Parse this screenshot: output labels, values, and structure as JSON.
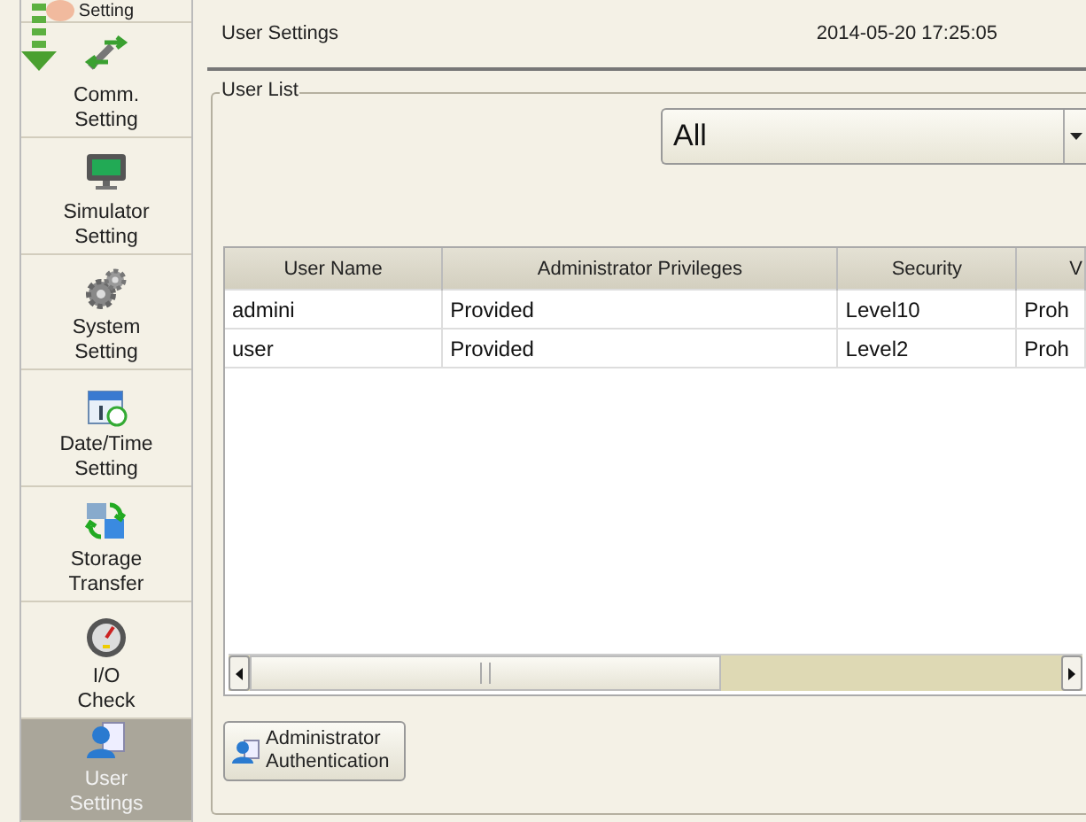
{
  "sidebar": {
    "items": [
      {
        "label": "Setting",
        "kind": "cut",
        "selected": false
      },
      {
        "label": "Comm.\nSetting",
        "kind": "comm",
        "selected": false
      },
      {
        "label": "Simulator\nSetting",
        "kind": "sim",
        "selected": false
      },
      {
        "label": "System\nSetting",
        "kind": "gears",
        "selected": false
      },
      {
        "label": "Date/Time\nSetting",
        "kind": "calendar",
        "selected": false
      },
      {
        "label": "Storage\nTransfer",
        "kind": "storage",
        "selected": false
      },
      {
        "label": "I/O\nCheck",
        "kind": "gauge",
        "selected": false
      },
      {
        "label": "User\nSettings",
        "kind": "user",
        "selected": true
      }
    ]
  },
  "header": {
    "title": "User Settings",
    "datetime": "2014-05-20  17:25:05"
  },
  "user_list": {
    "legend": "User List",
    "filter": {
      "value": "All"
    },
    "table": {
      "columns": [
        "User Name",
        "Administrator Privileges",
        "Security",
        "V"
      ],
      "rows": [
        [
          "admini",
          "Provided",
          "Level10",
          "Proh"
        ],
        [
          "user",
          "Provided",
          "Level2",
          "Proh"
        ]
      ]
    },
    "button": "Administrator\nAuthentication"
  }
}
